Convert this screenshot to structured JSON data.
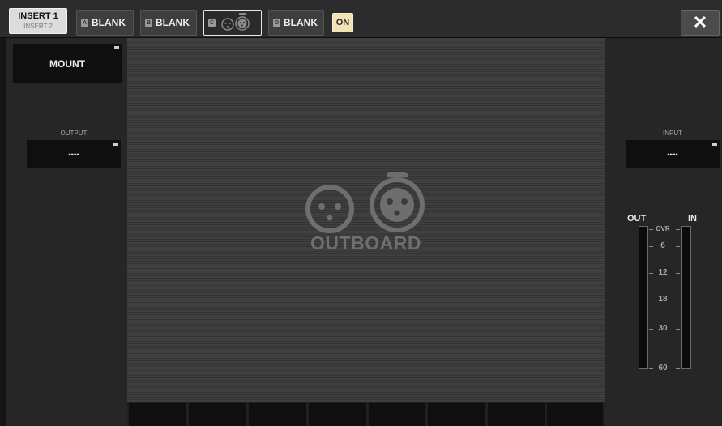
{
  "toolbar": {
    "insert_primary": "INSERT 1",
    "insert_secondary": "INSERT 2",
    "slots": [
      {
        "letter": "A",
        "label": "BLANK"
      },
      {
        "letter": "B",
        "label": "BLANK"
      },
      {
        "letter": "C",
        "icons": [
          "xlr-female-icon",
          "xlr-male-icon"
        ]
      },
      {
        "letter": "D",
        "label": "BLANK"
      }
    ],
    "on_label": "ON",
    "close_label": "✕"
  },
  "left_panel": {
    "mount_label": "MOUNT",
    "output_label": "OUTPUT",
    "output_value": "----"
  },
  "center": {
    "logo_text": "OUTBOARD",
    "logo_icons": [
      "xlr-female-icon",
      "xlr-male-icon"
    ]
  },
  "right_panel": {
    "input_label": "INPUT",
    "input_value": "----",
    "meter": {
      "out_label": "OUT",
      "in_label": "IN",
      "scale": [
        "OVR",
        "6",
        "12",
        "18",
        "30",
        "60"
      ]
    }
  },
  "colors": {
    "on_button": "#f3e2b5",
    "background": "#151515",
    "panel": "#262626"
  }
}
